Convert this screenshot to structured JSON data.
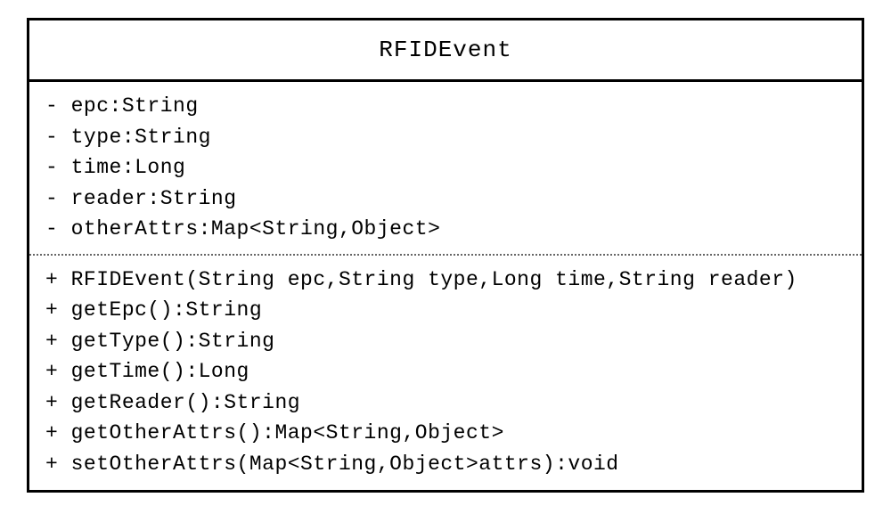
{
  "class": {
    "name": "RFIDEvent",
    "attributes": [
      "- epc:String",
      "- type:String",
      "- time:Long",
      "- reader:String",
      "- otherAttrs:Map<String,Object>"
    ],
    "methods": [
      "+ RFIDEvent(String epc,String type,Long time,String reader)",
      "+ getEpc():String",
      "+ getType():String",
      "+ getTime():Long",
      "+ getReader():String",
      "+ getOtherAttrs():Map<String,Object>",
      "+ setOtherAttrs(Map<String,Object>attrs):void"
    ]
  }
}
